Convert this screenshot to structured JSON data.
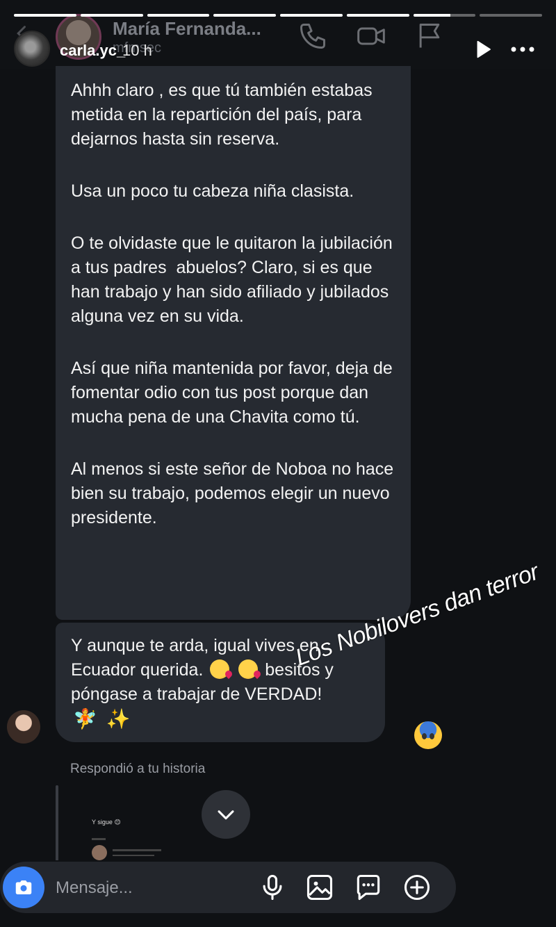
{
  "story": {
    "progress_segments": [
      1,
      1,
      1,
      1,
      1,
      1,
      0.6,
      0
    ],
    "username": "carla.yc_",
    "time_ago": "10 h"
  },
  "dm_header": {
    "contact_name": "María Fernanda...",
    "contact_handle": "mfmsec"
  },
  "messages": {
    "bubble1_paragraphs": [
      "Ahhh claro , es que tú también estabas metida en la repartición del país, para dejarnos hasta sin reserva.",
      "Usa un poco tu cabeza niña clasista.",
      "O te olvidaste que le quitaron la jubilación a tus padres  abuelos? Claro, si es que han trabajo y han sido afiliado y jubilados alguna vez en su vida.",
      "Así que niña mantenida por favor, deja de fomentar odio con tus post porque dan mucha pena de una Chavita como tú.",
      "Al menos si este señor de Noboa no hace bien su trabajo, podemos elegir un nuevo presidente."
    ],
    "bubble2_part1": "Y aunque te arda, igual vives en Ecuador querida.",
    "bubble2_part2": "besitos y póngase a trabajar de VERDAD!",
    "emoji_fairy": "🧚",
    "emoji_sparkles": "✨"
  },
  "sticker": {
    "text": "Los Nobilovers dan terror"
  },
  "reply": {
    "label": "Respondió a tu historia",
    "thumb_text": "Y sigue 😊"
  },
  "composer": {
    "placeholder": "Mensaje..."
  }
}
